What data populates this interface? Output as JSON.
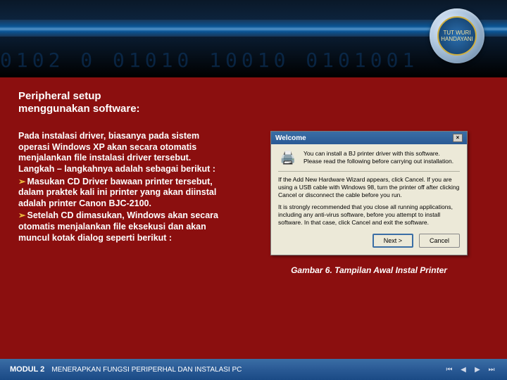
{
  "header": {
    "digits": "0102 0 01010 10010 0101001",
    "logo_text": "TUT WURI HANDAYANI"
  },
  "content": {
    "title_line1": "Peripheral setup",
    "title_line2": "menggunakan software:",
    "intro": "Pada instalasi driver, biasanya pada sistem operasi Windows XP akan secara otomatis menjalankan file instalasi driver tersebut. Langkah – langkahnya adalah sebagai berikut :",
    "bullets": [
      "Masukan CD Driver bawaan printer tersebut, dalam praktek kali ini printer yang akan diinstal adalah printer Canon BJC-2100.",
      "Setelah CD dimasukan, Windows akan secara otomatis menjalankan file eksekusi dan akan muncul kotak dialog seperti berikut :"
    ]
  },
  "dialog": {
    "title": "Welcome",
    "close": "×",
    "line1": "You can install a BJ printer driver with this software. Please read the following before carrying out installation.",
    "line2": "If the Add New Hardware Wizard appears, click Cancel. If you are using a USB cable with Windows 98, turn the printer off after clicking Cancel or disconnect the cable before you run.",
    "line3": "It is strongly recommended that you close all running applications, including any anti-virus software, before you attempt to install software. In that case, click Cancel and exit the software.",
    "next": "Next >",
    "cancel": "Cancel"
  },
  "caption": "Gambar 6. Tampilan Awal Instal Printer",
  "footer": {
    "modul": "MODUL 2",
    "subtitle": "MENERAPKAN FUNGSI PERIPERHAL DAN INSTALASI PC"
  }
}
